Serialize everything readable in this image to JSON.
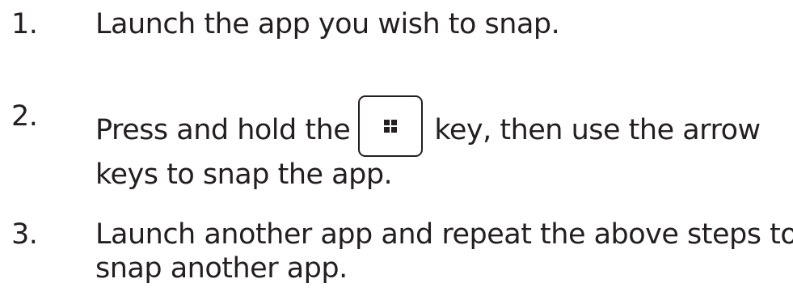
{
  "steps": [
    {
      "number": "1.",
      "lines": [
        "Launch the app you wish to snap."
      ]
    },
    {
      "number": "2.",
      "line1_before": "Press and hold the",
      "key_icon": "windows-logo-icon",
      "line1_after": "key, then use the arrow",
      "line2": "keys to snap the app."
    },
    {
      "number": "3.",
      "lines": [
        "Launch another app and repeat the above steps to",
        "snap another app."
      ]
    }
  ],
  "colors": {
    "text": "#231f20",
    "background": "#ffffff"
  }
}
